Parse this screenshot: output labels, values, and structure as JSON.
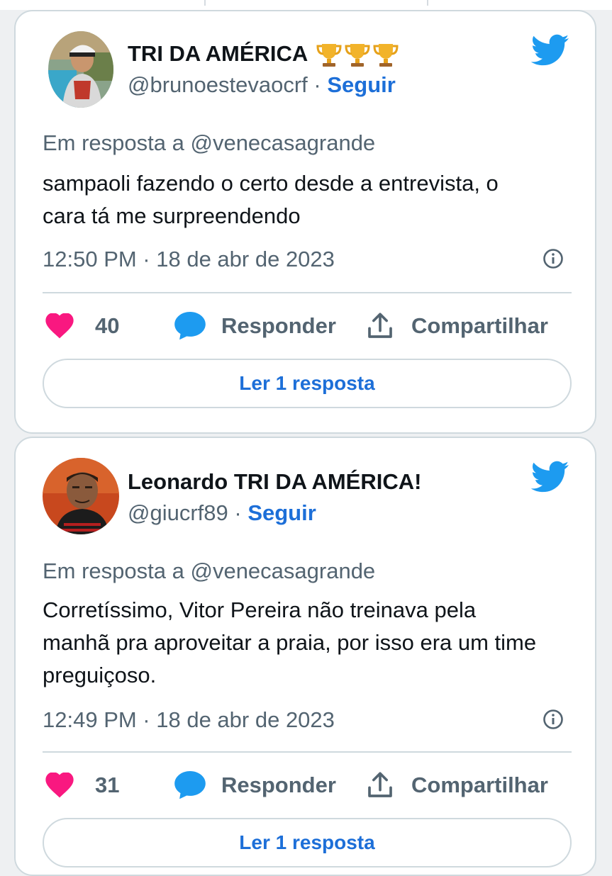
{
  "tweets": [
    {
      "display_name": "TRI DA AMÉRICA",
      "name_icons": [
        "trophy-icon",
        "trophy-icon",
        "trophy-icon"
      ],
      "handle": "@brunoestevaocrf",
      "separator": " · ",
      "follow_label": "Seguir",
      "reply_to": "Em resposta a @venecasagrande",
      "text_lines": [
        "sampaoli fazendo o certo desde a entrevista, o",
        "cara tá me surpreendendo"
      ],
      "timestamp": "12:50 PM · 18 de abr de 2023",
      "likes": "40",
      "reply_label": "Responder",
      "share_label": "Compartilhar",
      "read_replies_label": "Ler 1 resposta"
    },
    {
      "display_name": "Leonardo TRI DA AMÉRICA!",
      "handle": "@giucrf89",
      "separator": " · ",
      "follow_label": "Seguir",
      "reply_to": "Em resposta a @venecasagrande",
      "text_lines": [
        "Corretíssimo, Vitor Pereira não treinava pela",
        "manhã pra aproveitar a praia, por isso era um time",
        "preguiçoso."
      ],
      "timestamp": "12:49 PM · 18 de abr de 2023",
      "likes": "31",
      "reply_label": "Responder",
      "share_label": "Compartilhar",
      "read_replies_label": "Ler 1 resposta"
    }
  ],
  "colors": {
    "accent_blue": "#1d6fd8",
    "twitter_blue": "#1d9bf0",
    "like_pink": "#f91880",
    "muted_text": "#536471",
    "border": "#cfd9de"
  },
  "icons": {
    "brand": "twitter-bird-icon",
    "like": "heart-icon",
    "reply": "speech-bubble-icon",
    "share": "share-icon",
    "info": "info-icon"
  }
}
